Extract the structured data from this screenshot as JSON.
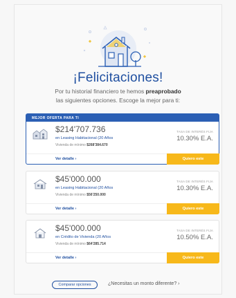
{
  "title": "¡Felicitaciones!",
  "subtitle_line1_pre": "Por tu historial financiero te hemos ",
  "subtitle_line1_bold": "preaprobado",
  "subtitle_line2": "las siguientes opciones. Escoge la mejor para ti:",
  "best_label": "MEJOR OFERTA PARA TI",
  "offers": [
    {
      "icon": "building-icon",
      "amount": "$214'707.736",
      "product": "en Leasing Habitacional (20 Años",
      "min_label": "Vivienda de mínimo ",
      "min_value": "$268'384.670",
      "rate_label": "TASA DE INTERÉS FIJA",
      "rate": "10.30% E.A.",
      "detail": "Ver detalle ›",
      "cta": "Quiero este"
    },
    {
      "icon": "house-icon",
      "amount": "$45'000.000",
      "product": "en Leasing Habitacional (20 Años",
      "min_label": "Vivienda de mínimo ",
      "min_value": "$56'250.000",
      "rate_label": "TASA DE INTERÉS FIJA",
      "rate": "10.30% E.A.",
      "detail": "Ver detalle ›",
      "cta": "Quiero este"
    },
    {
      "icon": "home-icon",
      "amount": "$45'000.000",
      "product": "en Crédito de Vivienda (20 Años",
      "min_label": "Vivienda de mínimo ",
      "min_value": "$64'285.714",
      "rate_label": "TASA DE INTERÉS FIJA",
      "rate": "10.50% E.A.",
      "detail": "Ver detalle ›",
      "cta": "Quiero este"
    }
  ],
  "compare_label": "Comparar opciones",
  "different_amount": "¿Necesitas un monto diferente? ›",
  "colors": {
    "primary": "#2b5fb4",
    "accent": "#f7b81a"
  }
}
